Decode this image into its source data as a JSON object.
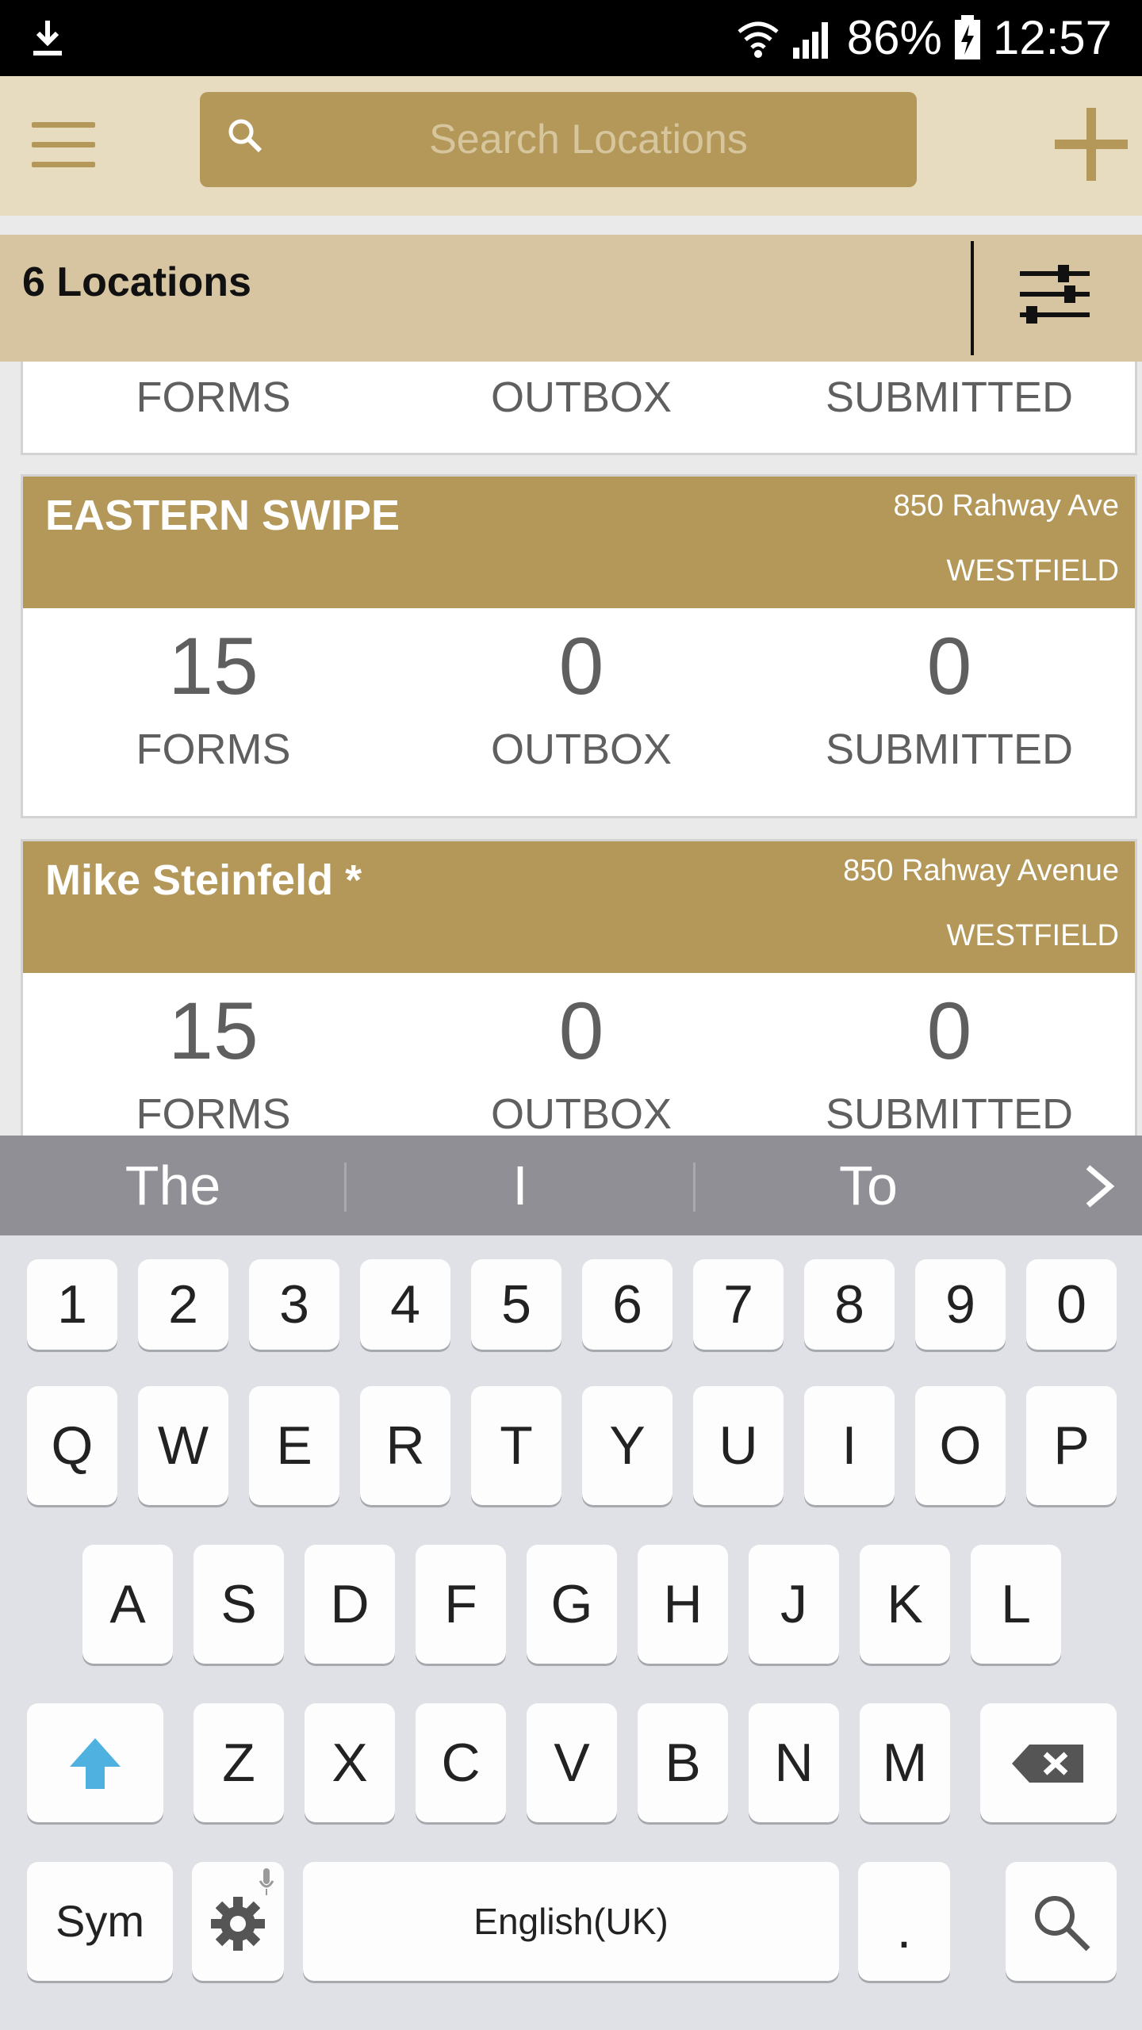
{
  "status_bar": {
    "battery": "86%",
    "time": "12:57"
  },
  "header": {
    "search_placeholder": "Search Locations"
  },
  "locations": {
    "count_label": "6 Locations"
  },
  "labels": {
    "forms": "FORMS",
    "outbox": "OUTBOX",
    "submitted": "SUBMITTED"
  },
  "cards": [
    {
      "name": "EASTERN SWIPE",
      "address": "850 Rahway Ave",
      "city": "WESTFIELD",
      "forms": "15",
      "outbox": "0",
      "submitted": "0"
    },
    {
      "name": "Mike Steinfeld *",
      "address": "850 Rahway Avenue",
      "city": "WESTFIELD",
      "forms": "15",
      "outbox": "0",
      "submitted": "0"
    }
  ],
  "keyboard": {
    "suggestions": [
      "The",
      "I",
      "To"
    ],
    "row_numbers": [
      "1",
      "2",
      "3",
      "4",
      "5",
      "6",
      "7",
      "8",
      "9",
      "0"
    ],
    "row1": [
      "Q",
      "W",
      "E",
      "R",
      "T",
      "Y",
      "U",
      "I",
      "O",
      "P"
    ],
    "row2": [
      "A",
      "S",
      "D",
      "F",
      "G",
      "H",
      "J",
      "K",
      "L"
    ],
    "row3": [
      "Z",
      "X",
      "C",
      "V",
      "B",
      "N",
      "M"
    ],
    "sym_label": "Sym",
    "space_label": "English(UK)",
    "period_label": "."
  },
  "colors": {
    "gold": "#b39859",
    "header_bg": "#e8dcc0",
    "loc_bar_bg": "#d6c5a0",
    "shift_blue": "#4fb1e0"
  }
}
